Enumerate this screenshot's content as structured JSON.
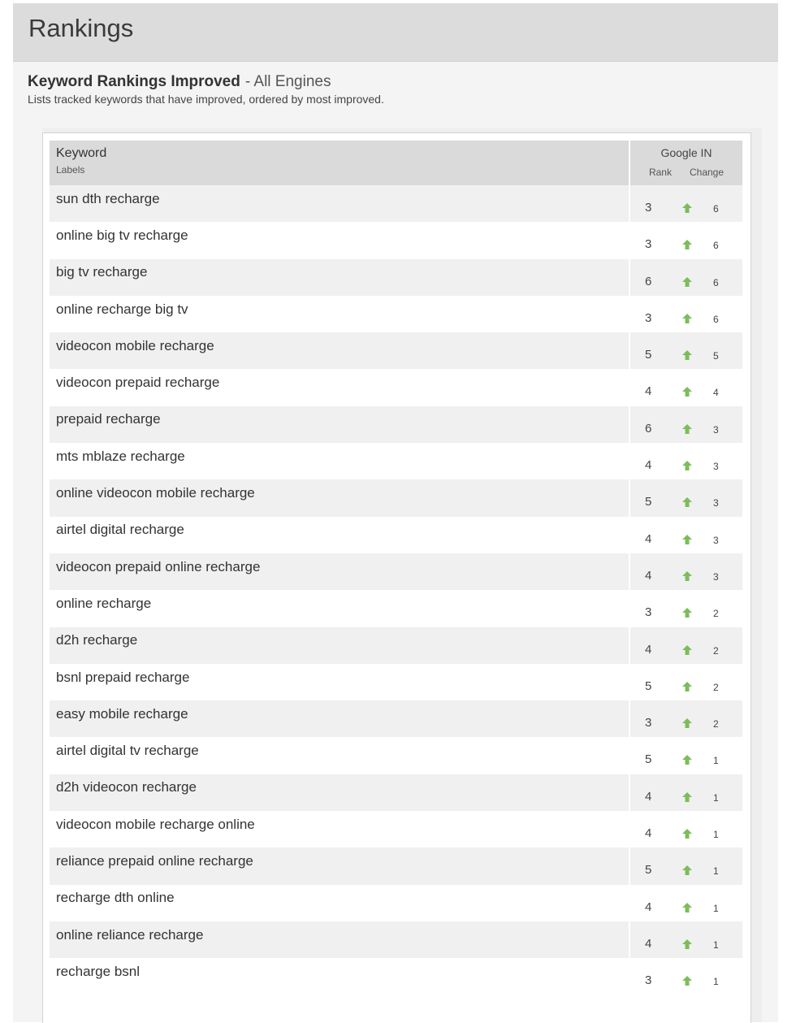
{
  "page": {
    "title": "Rankings"
  },
  "report": {
    "title": "Keyword Rankings Improved",
    "subtitle": "- All Engines",
    "description": "Lists tracked keywords that have improved, ordered by most improved."
  },
  "table": {
    "col_keyword": "Keyword",
    "col_labels": "Labels",
    "engine": "Google IN",
    "col_rank": "Rank",
    "col_change": "Change",
    "arrow_icon": "arrow-up-icon",
    "arrow_color": "#7cbd5a",
    "rows": [
      {
        "keyword": "sun dth recharge",
        "rank": "3",
        "change": "6"
      },
      {
        "keyword": "online big tv recharge",
        "rank": "3",
        "change": "6"
      },
      {
        "keyword": "big tv recharge",
        "rank": "6",
        "change": "6"
      },
      {
        "keyword": "online recharge big tv",
        "rank": "3",
        "change": "6"
      },
      {
        "keyword": "videocon mobile recharge",
        "rank": "5",
        "change": "5"
      },
      {
        "keyword": "videocon prepaid recharge",
        "rank": "4",
        "change": "4"
      },
      {
        "keyword": "prepaid recharge",
        "rank": "6",
        "change": "3"
      },
      {
        "keyword": "mts mblaze recharge",
        "rank": "4",
        "change": "3"
      },
      {
        "keyword": "online videocon mobile recharge",
        "rank": "5",
        "change": "3"
      },
      {
        "keyword": "airtel digital recharge",
        "rank": "4",
        "change": "3"
      },
      {
        "keyword": "videocon prepaid online recharge",
        "rank": "4",
        "change": "3"
      },
      {
        "keyword": "online recharge",
        "rank": "3",
        "change": "2"
      },
      {
        "keyword": "d2h recharge",
        "rank": "4",
        "change": "2"
      },
      {
        "keyword": "bsnl prepaid recharge",
        "rank": "5",
        "change": "2"
      },
      {
        "keyword": "easy mobile recharge",
        "rank": "3",
        "change": "2"
      },
      {
        "keyword": "airtel digital tv recharge",
        "rank": "5",
        "change": "1"
      },
      {
        "keyword": "d2h videocon recharge",
        "rank": "4",
        "change": "1"
      },
      {
        "keyword": "videocon mobile recharge online",
        "rank": "4",
        "change": "1"
      },
      {
        "keyword": "reliance prepaid online recharge",
        "rank": "5",
        "change": "1"
      },
      {
        "keyword": "recharge dth online",
        "rank": "4",
        "change": "1"
      },
      {
        "keyword": "online reliance recharge",
        "rank": "4",
        "change": "1"
      },
      {
        "keyword": "recharge bsnl",
        "rank": "3",
        "change": "1"
      }
    ]
  }
}
